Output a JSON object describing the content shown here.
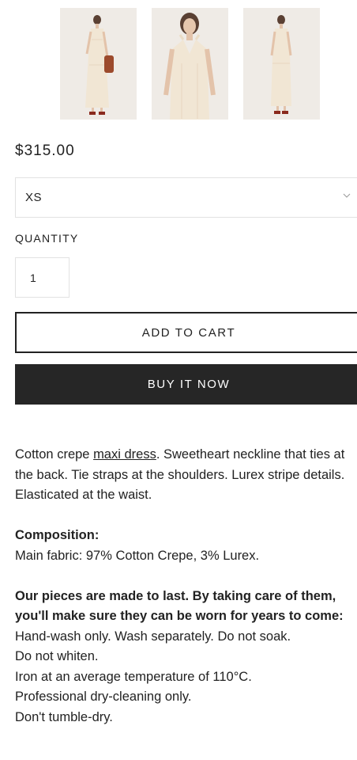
{
  "gallery": {
    "images": [
      {
        "icon": "model-with-bag-photo"
      },
      {
        "icon": "model-closeup-photo"
      },
      {
        "icon": "model-full-length-photo"
      }
    ]
  },
  "product": {
    "price": "$315.00",
    "size_value": "XS",
    "quantity_label": "QUANTITY",
    "quantity_value": "1",
    "add_to_cart_label": "ADD TO CART",
    "buy_now_label": "BUY IT NOW"
  },
  "description": {
    "intro_prefix": "Cotton crepe ",
    "intro_link": "maxi dress",
    "intro_suffix": ". Sweetheart neckline that ties at the back. Tie straps at the shoulders. Lurex stripe details. Elasticated at the waist.",
    "composition_heading": "Composition:",
    "composition_text": "Main fabric: 97% Cotton Crepe, 3% Lurex.",
    "care_heading": "Our pieces are made to last. By taking care of them, you'll make sure they can be worn for years to come:",
    "care_lines": [
      "Hand-wash only. Wash separately. Do not soak.",
      "Do not whiten.",
      "Iron at an average temperature of 110°C.",
      "Professional dry-cleaning only.",
      "Don't tumble-dry."
    ]
  },
  "colors": {
    "buy_now_bg": "#262626",
    "text": "#222222",
    "border": "#e2e2e2",
    "dress": "#f1e6d4",
    "photo_bg": "#efebe6"
  }
}
